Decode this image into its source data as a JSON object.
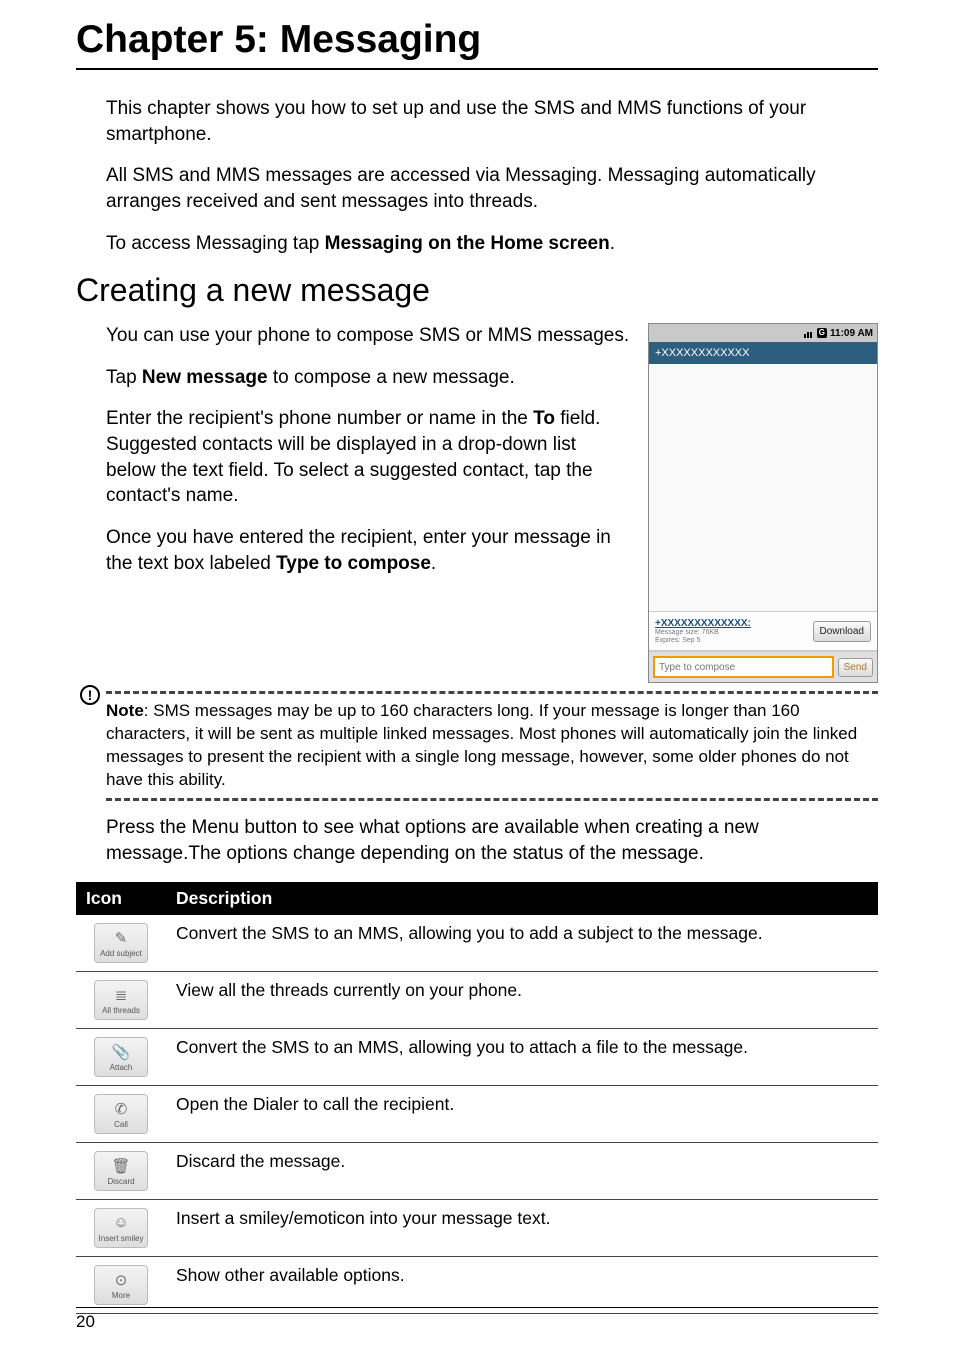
{
  "chapter": {
    "title": "Chapter 5: Messaging"
  },
  "intro": {
    "p1": "This chapter shows you how to set up and use the SMS and MMS functions of your smartphone.",
    "p2": "All SMS and MMS messages are accessed via Messaging. Messaging automatically arranges received and sent messages into threads.",
    "p3_prefix": "To access Messaging tap ",
    "p3_bold": "Messaging on the Home screen",
    "p3_suffix": "."
  },
  "section": {
    "title": "Creating a new message",
    "p1": "You can use your phone to compose SMS or MMS messages.",
    "p2_prefix": "Tap ",
    "p2_bold": "New message",
    "p2_suffix": " to compose a new message.",
    "p3_prefix": "Enter the recipient's phone number or name in the ",
    "p3_bold": "To",
    "p3_suffix": " field. Suggested contacts will be displayed in a drop-down list below the text field. To select a suggested contact, tap the contact's name.",
    "p4_prefix": "Once you have entered the recipient, enter your message in the text box labeled ",
    "p4_bold": "Type to compose",
    "p4_suffix": "."
  },
  "screenshot": {
    "time": "11:09 AM",
    "g_label": "G",
    "to_field": "+XXXXXXXXXXXX",
    "mms_from": "+XXXXXXXXXXXXX:",
    "mms_size": "Message size: 76KB",
    "mms_expires": "Expires: Sep 5",
    "download_label": "Download",
    "compose_placeholder": "Type to compose",
    "send_label": "Send"
  },
  "note": {
    "label": "Note",
    "text": ": SMS messages may be up to 160 characters long. If your message is longer than 160 characters, it will be sent as multiple linked messages. Most phones will automatically join the linked messages to present the recipient with a single long message, however, some older phones do not have this ability."
  },
  "after_note": "Press the Menu button to see what options are available when creating a new message.The options change depending on the status of the message.",
  "table": {
    "head_icon": "Icon",
    "head_desc": "Description",
    "rows": [
      {
        "icon_label": "Add subject",
        "glyph": "✎",
        "desc": "Convert the SMS to an MMS, allowing you to add a subject to the message."
      },
      {
        "icon_label": "All threads",
        "glyph": "≣",
        "desc": "View all the threads currently on your phone."
      },
      {
        "icon_label": "Attach",
        "glyph": "📎",
        "desc": "Convert the SMS to an MMS, allowing you to attach a file to the message."
      },
      {
        "icon_label": "Call",
        "glyph": "✆",
        "desc": "Open the Dialer to call the recipient."
      },
      {
        "icon_label": "Discard",
        "glyph": "🗑",
        "desc": "Discard the message."
      },
      {
        "icon_label": "Insert smiley",
        "glyph": "☺",
        "desc": "Insert a smiley/emoticon into your message text."
      },
      {
        "icon_label": "More",
        "glyph": "⊙",
        "desc": "Show other available options."
      }
    ]
  },
  "page_number": "20"
}
